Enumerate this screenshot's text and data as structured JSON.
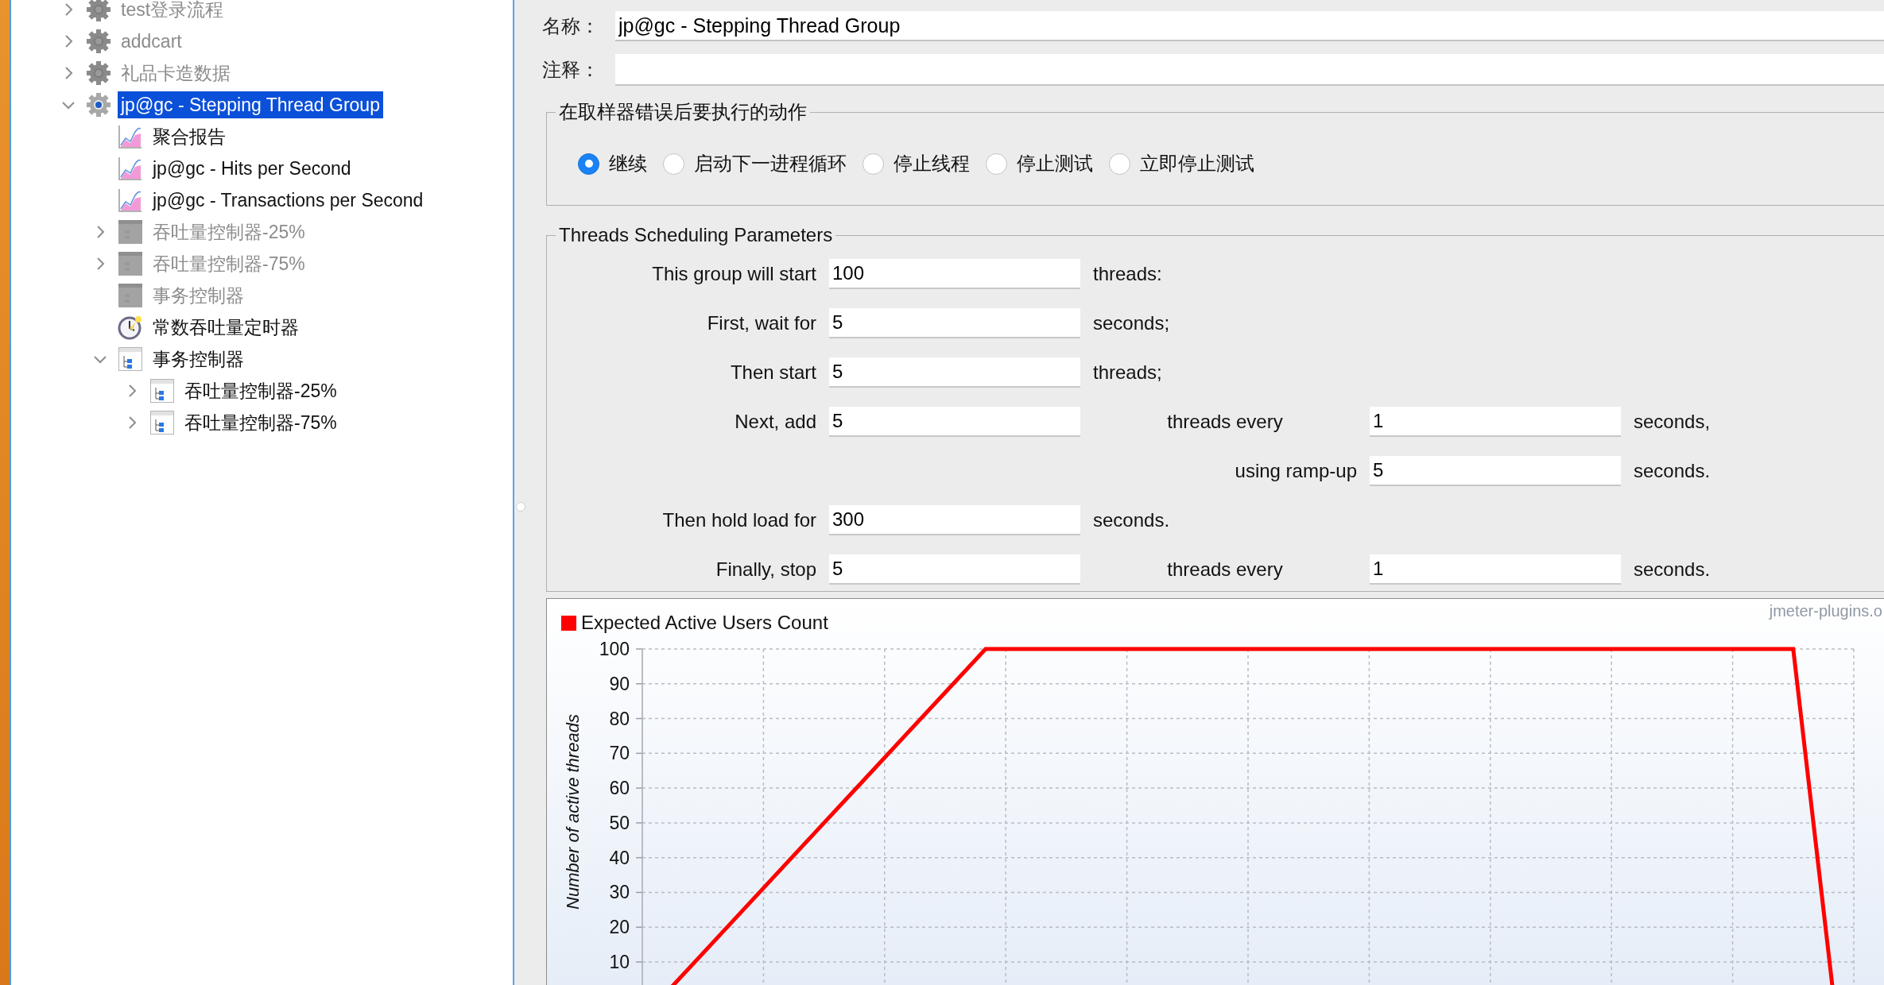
{
  "tree": [
    {
      "label": "test登录流程",
      "kind": "thread-group",
      "disabled": true,
      "expanded": false,
      "selected": false
    },
    {
      "label": "addcart",
      "kind": "thread-group",
      "disabled": true,
      "expanded": false,
      "selected": false
    },
    {
      "label": "礼品卡造数据",
      "kind": "thread-group",
      "disabled": true,
      "expanded": false,
      "selected": false
    },
    {
      "label": "jp@gc - Stepping Thread Group",
      "kind": "thread-group",
      "disabled": false,
      "expanded": true,
      "selected": true,
      "children": [
        {
          "label": "聚合报告",
          "kind": "listener",
          "disabled": false,
          "selected": false
        },
        {
          "label": "jp@gc - Hits per Second",
          "kind": "listener",
          "disabled": false,
          "selected": false
        },
        {
          "label": "jp@gc - Transactions per Second",
          "kind": "listener",
          "disabled": false,
          "selected": false
        },
        {
          "label": "吞吐量控制器-25%",
          "kind": "controller",
          "disabled": true,
          "expanded": false,
          "selected": false
        },
        {
          "label": "吞吐量控制器-75%",
          "kind": "controller",
          "disabled": true,
          "expanded": false,
          "selected": false
        },
        {
          "label": "事务控制器",
          "kind": "controller",
          "disabled": true,
          "selected": false
        },
        {
          "label": "常数吞吐量定时器",
          "kind": "timer",
          "disabled": false,
          "selected": false
        },
        {
          "label": "事务控制器",
          "kind": "controller",
          "disabled": false,
          "expanded": true,
          "selected": false,
          "children": [
            {
              "label": "吞吐量控制器-25%",
              "kind": "controller",
              "disabled": false,
              "expanded": false,
              "selected": false
            },
            {
              "label": "吞吐量控制器-75%",
              "kind": "controller",
              "disabled": false,
              "expanded": false,
              "selected": false
            }
          ]
        }
      ]
    }
  ],
  "form": {
    "name_label": "名称：",
    "name_value": "jp@gc - Stepping Thread Group",
    "comment_label": "注释："
  },
  "on_error": {
    "title": "在取样器错误后要执行的动作",
    "options": [
      {
        "label": "继续",
        "selected": true
      },
      {
        "label": "启动下一进程循环",
        "selected": false
      },
      {
        "label": "停止线程",
        "selected": false
      },
      {
        "label": "停止测试",
        "selected": false
      },
      {
        "label": "立即停止测试",
        "selected": false
      }
    ]
  },
  "schedule": {
    "title": "Threads Scheduling Parameters",
    "rows": [
      {
        "label": "This group will start",
        "value": "100",
        "unit": "threads:"
      },
      {
        "label": "First, wait for",
        "value": "5",
        "unit": "seconds;"
      },
      {
        "label": "Then start",
        "value": "5",
        "unit": "threads;"
      },
      {
        "label": "Next, add",
        "value": "5",
        "label2": "threads every",
        "value2": "1",
        "unit2": "seconds,"
      },
      {
        "label2": "using ramp-up",
        "value2": "5",
        "unit2": "seconds."
      },
      {
        "label": "Then hold load for",
        "value": "300",
        "unit": "seconds."
      },
      {
        "label": "Finally, stop",
        "value": "5",
        "label2": "threads every",
        "value2": "1",
        "unit2": "seconds."
      }
    ]
  },
  "chart": {
    "watermark": "jmeter-plugins.o",
    "chart_data": {
      "type": "line",
      "ylabel": "Number of active threads",
      "categories": [
        null,
        null,
        null,
        null,
        null,
        null,
        null,
        null,
        null,
        null,
        null,
        null,
        null,
        null,
        null,
        null,
        null,
        null,
        null,
        null,
        null,
        null,
        null,
        null,
        null,
        null,
        null,
        null,
        null,
        null
      ],
      "ylim": [
        0,
        100
      ],
      "grid": true,
      "yticks": [
        10,
        20,
        30,
        40,
        50,
        60,
        70,
        80,
        90,
        100
      ],
      "series": [
        {
          "name": "Expected Active Users Count",
          "color": "#ff0000",
          "values": [
            0,
            12.5,
            25,
            37.5,
            50,
            62.5,
            75,
            87.5,
            100,
            100,
            100,
            100,
            100,
            100,
            100,
            100,
            100,
            100,
            100,
            100,
            100,
            100,
            100,
            100,
            100,
            100,
            100,
            100,
            100,
            0
          ]
        }
      ]
    }
  }
}
